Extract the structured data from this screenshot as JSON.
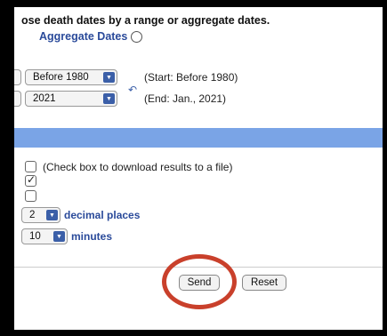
{
  "header": {
    "title": "ose death dates by a range or aggregate dates.",
    "aggregate_label": "Aggregate Dates"
  },
  "date_range": {
    "start_value": "Before 1980",
    "end_value": "2021",
    "start_note": "(Start: Before 1980)",
    "end_note": "(End: Jan., 2021)"
  },
  "options": {
    "download_label": "(Check box to download results to a file)",
    "download_checked": false,
    "second_checked": true,
    "third_checked": false,
    "decimal_value": "2",
    "decimal_label": "decimal places",
    "minutes_value": "10",
    "minutes_label": "minutes"
  },
  "actions": {
    "send_label": "Send",
    "reset_label": "Reset"
  },
  "annotation": {
    "ring_color": "#c9402b"
  },
  "colors": {
    "accent_bar": "#7aa4e6",
    "label_blue": "#2a4a9a",
    "select_arrow": "#3b5fa8"
  }
}
